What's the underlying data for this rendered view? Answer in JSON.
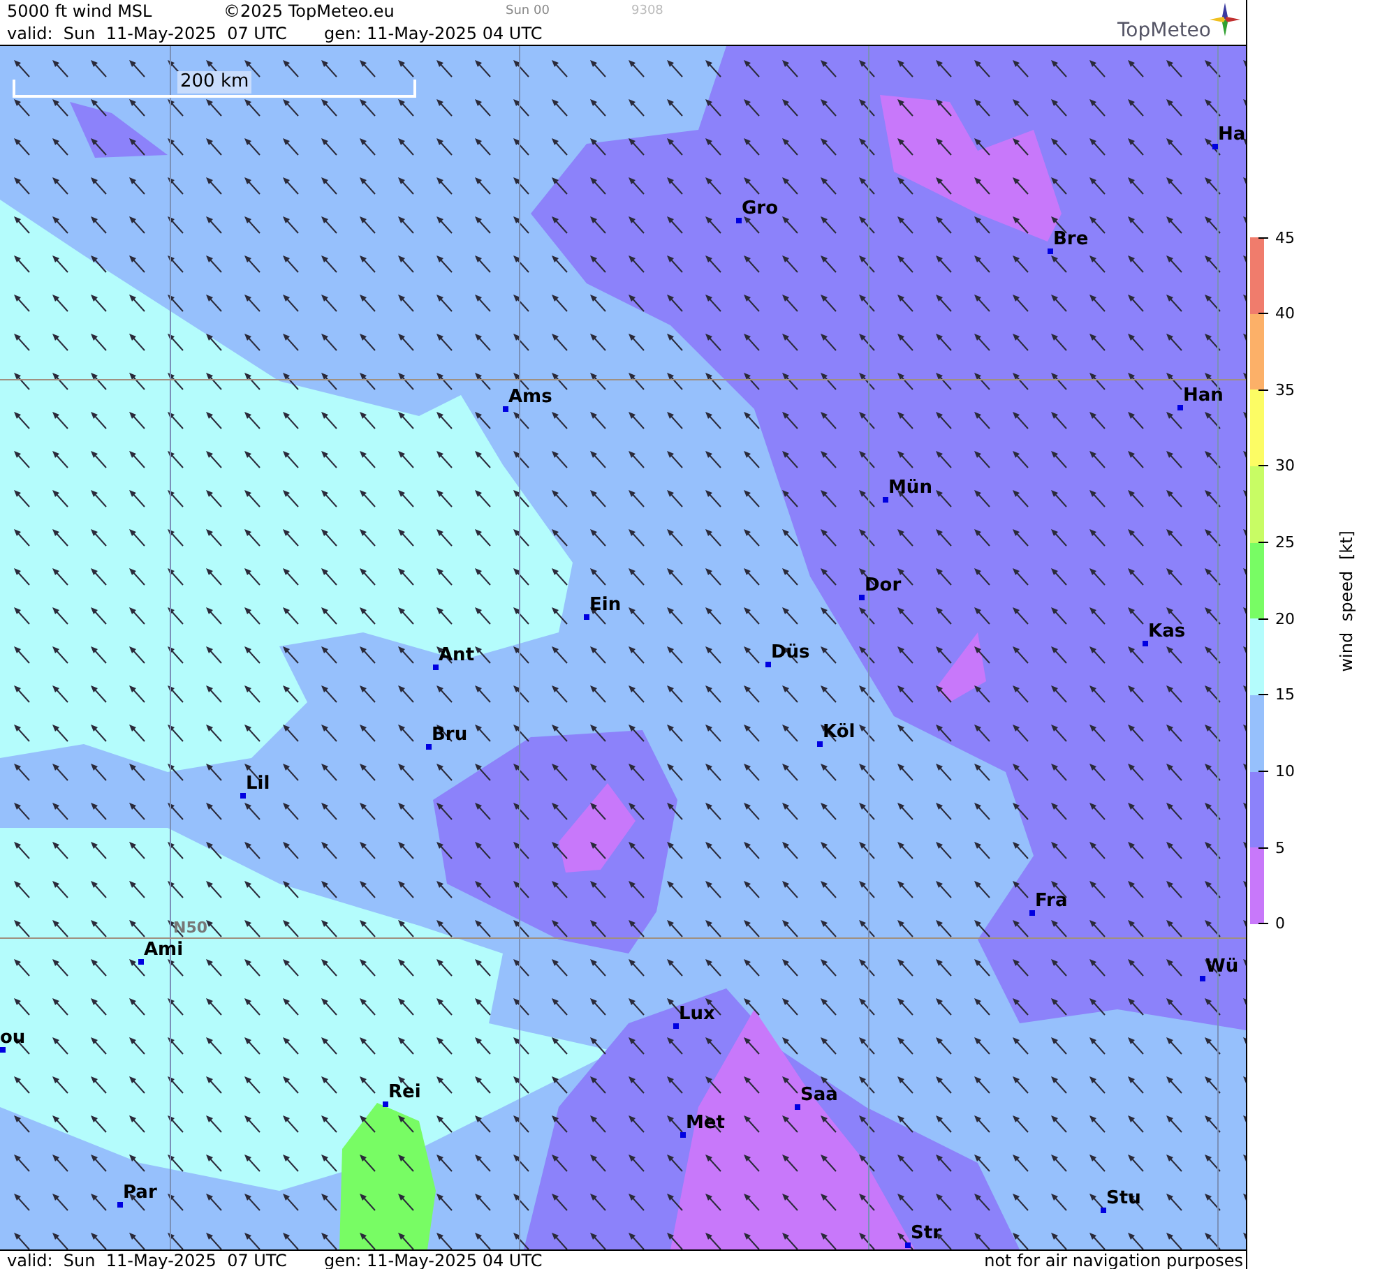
{
  "header": {
    "title": "5000 ft wind MSL",
    "copyright": "©2025 TopMeteo.eu",
    "run": "Sun 00",
    "code": "9308",
    "valid": "valid:  Sun  11-May-2025  07 UTC",
    "generated": "gen: 11-May-2025 04 UTC",
    "logo": "TopMeteo"
  },
  "map": {
    "scale_label": "200 km",
    "latitude_label": "N50",
    "cities": [
      {
        "name": "Ha"
      },
      {
        "name": "Gro"
      },
      {
        "name": "Bre"
      },
      {
        "name": "Han"
      },
      {
        "name": "Ams"
      },
      {
        "name": "Mün"
      },
      {
        "name": "Dor"
      },
      {
        "name": "Ein"
      },
      {
        "name": "Kas"
      },
      {
        "name": "Düs"
      },
      {
        "name": "Ant"
      },
      {
        "name": "Köl"
      },
      {
        "name": "Bru"
      },
      {
        "name": "Lil"
      },
      {
        "name": "Fra"
      },
      {
        "name": "Ami"
      },
      {
        "name": "Wü"
      },
      {
        "name": "Lux"
      },
      {
        "name": "ou"
      },
      {
        "name": "Rei"
      },
      {
        "name": "Saa"
      },
      {
        "name": "Met"
      },
      {
        "name": "Par"
      },
      {
        "name": "Stu"
      },
      {
        "name": "Str"
      }
    ]
  },
  "legend": {
    "title": "wind speed [kt]",
    "segments": [
      {
        "color": "#f07c6c"
      },
      {
        "color": "#fcb068"
      },
      {
        "color": "#fcfc64"
      },
      {
        "color": "#c8fc64"
      },
      {
        "color": "#78fc64"
      },
      {
        "color": "#b4fcfc"
      },
      {
        "color": "#96c0fc"
      },
      {
        "color": "#8c82fa"
      },
      {
        "color": "#c878fa"
      }
    ],
    "ticks": [
      "45",
      "40",
      "35",
      "30",
      "25",
      "20",
      "15",
      "10",
      "5",
      "0"
    ]
  },
  "footer": {
    "valid": "valid:  Sun  11-May-2025  07 UTC",
    "generated": "gen: 11-May-2025 04 UTC",
    "notice": "not for air navigation purposes"
  }
}
